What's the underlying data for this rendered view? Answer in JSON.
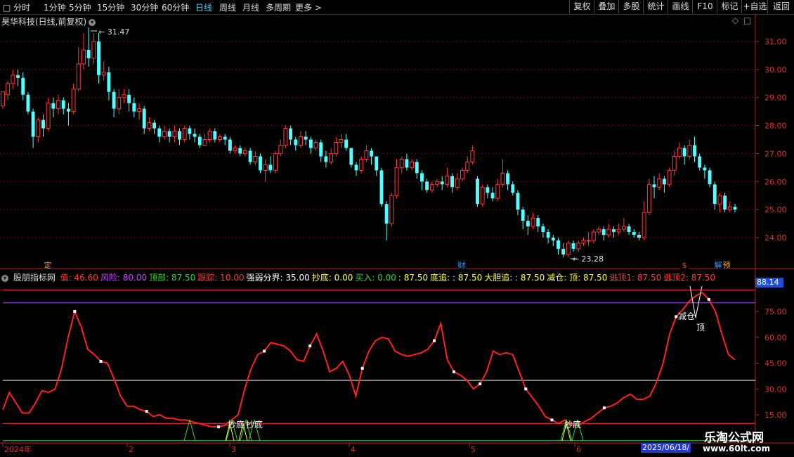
{
  "toolbar": {
    "periods": [
      "分时",
      "1分钟",
      "5分钟",
      "15分钟",
      "30分钟",
      "60分钟",
      "日线",
      "周线",
      "月线",
      "多周期",
      "更多"
    ],
    "active_period": "日线",
    "buttons": [
      "复权",
      "叠加",
      "多股",
      "统计",
      "画线",
      "F10",
      "标记",
      "+自选",
      "返回"
    ]
  },
  "chart_title": "昊华科技(日线,前复权)",
  "price_axis": [
    "31.00",
    "30.00",
    "29.00",
    "28.00",
    "27.00",
    "26.00",
    "25.00",
    "24.00"
  ],
  "high_label": "31.47",
  "low_label": "23.28",
  "event_badges": [
    {
      "text": "定",
      "color": "#f5a623"
    },
    {
      "text": "财",
      "color": "#3ba0ff"
    },
    {
      "text": "$",
      "color": "#ff3030"
    },
    {
      "text": "解",
      "color": "#3ba0ff"
    },
    {
      "text": "预",
      "color": "#f5a623"
    }
  ],
  "indicator": {
    "name": "股朋指标网",
    "items": [
      {
        "text": "值: 46.60",
        "color": "#ff3b3b"
      },
      {
        "text": "风险: 80.00",
        "color": "#d040ff"
      },
      {
        "text": "顶部: 87.50",
        "color": "#3bd33b"
      },
      {
        "text": "跟踪: 10.00",
        "color": "#ff3b3b"
      },
      {
        "text": "强弱分界: 35.00",
        "color": "#ffffff"
      },
      {
        "text": "抄底: 0.00",
        "color": "#ffff40"
      },
      {
        "text": "买入: 0.00",
        "color": "#3bd33b"
      },
      {
        "text": ": 87.50",
        "color": "#ffff40"
      },
      {
        "text": "底追: : 87.50",
        "color": "#ffff40"
      },
      {
        "text": "大胆追: : 87.50",
        "color": "#ffff40"
      },
      {
        "text": "减仓: 顶: 87.50",
        "color": "#ffff40"
      },
      {
        "text": "逃顶1: 87.50",
        "color": "#ff3b3b"
      },
      {
        "text": "逃顶2: 87.50",
        "color": "#ff3b3b"
      }
    ],
    "axis": [
      "75.00",
      "60.00",
      "45.00",
      "30.00",
      "15.00"
    ],
    "current_value": "88.14",
    "signal_labels": [
      "抄底",
      "抄底",
      "抄底",
      "减仓",
      "顶"
    ]
  },
  "date_axis": [
    "2024年",
    "2",
    "3",
    "4",
    "5",
    "6"
  ],
  "cursor_date": "2025/06/18/",
  "watermark": {
    "name": "乐淘公式网",
    "url": "www.60lt.com"
  },
  "chart_data": {
    "type": "candlestick",
    "price_range": [
      23.0,
      31.8
    ],
    "candles": [
      [
        28.7,
        29.2,
        29.2,
        28.6
      ],
      [
        29.1,
        29.5,
        29.6,
        28.9
      ],
      [
        29.5,
        29.8,
        30.0,
        29.3
      ],
      [
        29.8,
        29.7,
        30.0,
        29.4
      ],
      [
        29.7,
        29.1,
        29.9,
        28.9
      ],
      [
        29.1,
        28.5,
        29.2,
        28.4
      ],
      [
        28.5,
        27.6,
        28.6,
        27.2
      ],
      [
        27.6,
        28.2,
        28.3,
        27.4
      ],
      [
        28.2,
        27.9,
        28.4,
        27.6
      ],
      [
        27.9,
        28.8,
        29.0,
        27.8
      ],
      [
        28.8,
        28.6,
        29.0,
        28.3
      ],
      [
        28.6,
        28.9,
        29.1,
        28.4
      ],
      [
        28.9,
        28.6,
        29.0,
        28.4
      ],
      [
        28.6,
        28.5,
        28.8,
        28.0
      ],
      [
        28.5,
        29.3,
        29.5,
        28.4
      ],
      [
        29.3,
        30.2,
        30.8,
        29.2
      ],
      [
        30.2,
        30.7,
        31.3,
        30.0
      ],
      [
        30.7,
        30.4,
        31.5,
        30.1
      ],
      [
        30.4,
        31.0,
        31.3,
        30.2
      ],
      [
        31.0,
        29.8,
        31.3,
        29.5
      ],
      [
        29.8,
        29.9,
        30.3,
        29.6
      ],
      [
        29.9,
        29.2,
        30.1,
        28.9
      ],
      [
        29.2,
        28.6,
        29.3,
        28.3
      ],
      [
        28.6,
        29.0,
        29.3,
        28.4
      ],
      [
        29.0,
        29.1,
        29.3,
        28.8
      ],
      [
        29.1,
        28.8,
        29.3,
        28.5
      ],
      [
        28.8,
        28.5,
        29.0,
        28.3
      ],
      [
        28.5,
        28.6,
        28.8,
        28.2
      ],
      [
        28.6,
        27.9,
        28.7,
        27.7
      ],
      [
        27.9,
        28.1,
        28.3,
        27.8
      ],
      [
        28.1,
        27.9,
        28.2,
        27.7
      ],
      [
        27.9,
        27.6,
        28.0,
        27.4
      ],
      [
        27.6,
        27.8,
        28.0,
        27.5
      ],
      [
        27.8,
        27.6,
        27.9,
        27.4
      ],
      [
        27.6,
        27.8,
        28.0,
        27.4
      ],
      [
        27.8,
        27.5,
        27.9,
        27.3
      ],
      [
        27.5,
        27.9,
        28.0,
        27.4
      ],
      [
        27.9,
        27.7,
        28.0,
        27.5
      ],
      [
        27.7,
        27.6,
        27.9,
        27.4
      ],
      [
        27.6,
        27.3,
        27.7,
        27.2
      ],
      [
        27.3,
        27.5,
        27.7,
        27.3
      ],
      [
        27.5,
        27.8,
        27.9,
        27.4
      ],
      [
        27.8,
        27.5,
        27.9,
        27.4
      ],
      [
        27.5,
        27.6,
        27.7,
        27.4
      ],
      [
        27.6,
        27.5,
        27.7,
        27.3
      ],
      [
        27.5,
        27.1,
        27.6,
        27.0
      ],
      [
        27.1,
        27.2,
        27.3,
        27.0
      ],
      [
        27.2,
        27.0,
        27.3,
        26.9
      ],
      [
        27.0,
        27.1,
        27.2,
        26.9
      ],
      [
        27.1,
        26.7,
        27.2,
        26.6
      ],
      [
        26.7,
        26.9,
        27.1,
        26.6
      ],
      [
        26.9,
        26.4,
        27.0,
        26.3
      ],
      [
        26.4,
        26.6,
        26.8,
        26.0
      ],
      [
        26.6,
        26.4,
        26.9,
        26.3
      ],
      [
        26.4,
        27.0,
        27.1,
        26.3
      ],
      [
        27.0,
        27.3,
        27.5,
        26.9
      ],
      [
        27.3,
        27.9,
        28.0,
        27.2
      ],
      [
        27.9,
        27.5,
        28.0,
        27.3
      ],
      [
        27.5,
        27.3,
        27.6,
        27.1
      ],
      [
        27.3,
        27.6,
        27.8,
        27.2
      ],
      [
        27.6,
        27.5,
        27.8,
        27.3
      ],
      [
        27.5,
        27.2,
        27.6,
        27.0
      ],
      [
        27.2,
        27.4,
        27.5,
        27.1
      ],
      [
        27.4,
        26.9,
        27.5,
        26.7
      ],
      [
        26.9,
        26.7,
        27.1,
        26.5
      ],
      [
        26.7,
        27.0,
        27.2,
        26.6
      ],
      [
        27.0,
        27.4,
        27.6,
        26.9
      ],
      [
        27.4,
        27.5,
        27.7,
        27.2
      ],
      [
        27.5,
        27.2,
        27.7,
        27.1
      ],
      [
        27.2,
        26.6,
        27.2,
        26.5
      ],
      [
        26.6,
        26.4,
        26.7,
        26.2
      ],
      [
        26.4,
        26.8,
        26.9,
        26.3
      ],
      [
        26.8,
        27.1,
        27.3,
        26.7
      ],
      [
        27.1,
        26.9,
        27.2,
        26.6
      ],
      [
        26.9,
        26.4,
        26.9,
        26.2
      ],
      [
        26.4,
        25.2,
        26.5,
        25.1
      ],
      [
        25.2,
        24.5,
        25.3,
        23.9
      ],
      [
        24.5,
        25.5,
        25.6,
        24.4
      ],
      [
        25.5,
        26.5,
        26.8,
        25.4
      ],
      [
        26.5,
        26.8,
        26.9,
        26.3
      ],
      [
        26.8,
        26.5,
        27.0,
        26.4
      ],
      [
        26.5,
        26.7,
        26.8,
        26.4
      ],
      [
        26.7,
        26.3,
        26.8,
        26.1
      ],
      [
        26.3,
        26.0,
        26.4,
        25.7
      ],
      [
        26.0,
        25.7,
        26.1,
        25.6
      ],
      [
        25.7,
        25.9,
        26.0,
        25.6
      ],
      [
        25.9,
        26.0,
        26.1,
        25.8
      ],
      [
        26.0,
        25.9,
        26.2,
        25.7
      ],
      [
        25.9,
        26.2,
        26.5,
        25.8
      ],
      [
        26.2,
        25.8,
        26.3,
        25.6
      ],
      [
        25.8,
        26.1,
        26.3,
        25.7
      ],
      [
        26.1,
        26.4,
        26.5,
        26.0
      ],
      [
        26.4,
        26.7,
        26.9,
        26.3
      ],
      [
        26.7,
        27.1,
        27.3,
        26.6
      ],
      [
        26.1,
        25.2,
        26.2,
        25.1
      ],
      [
        25.2,
        25.8,
        25.9,
        25.1
      ],
      [
        25.8,
        25.6,
        25.9,
        25.4
      ],
      [
        25.6,
        25.4,
        25.8,
        25.3
      ],
      [
        25.4,
        25.9,
        26.1,
        25.3
      ],
      [
        25.9,
        26.3,
        26.8,
        25.8
      ],
      [
        26.3,
        25.9,
        26.4,
        25.7
      ],
      [
        25.9,
        25.6,
        26.0,
        25.5
      ],
      [
        25.6,
        25.0,
        25.7,
        24.8
      ],
      [
        25.0,
        24.6,
        25.1,
        24.3
      ],
      [
        24.6,
        24.4,
        24.8,
        24.1
      ],
      [
        24.4,
        24.7,
        24.9,
        24.3
      ],
      [
        24.7,
        24.4,
        24.8,
        24.2
      ],
      [
        24.4,
        24.2,
        24.5,
        24.0
      ],
      [
        24.2,
        24.0,
        24.3,
        23.8
      ],
      [
        24.0,
        23.9,
        24.1,
        23.7
      ],
      [
        23.9,
        23.6,
        24.0,
        23.4
      ],
      [
        23.6,
        23.4,
        23.8,
        23.3
      ],
      [
        23.4,
        23.8,
        23.9,
        23.3
      ],
      [
        23.8,
        23.6,
        23.9,
        23.5
      ],
      [
        23.6,
        23.8,
        23.9,
        23.5
      ],
      [
        23.8,
        23.9,
        24.0,
        23.7
      ],
      [
        23.9,
        23.9,
        24.2,
        23.7
      ],
      [
        23.9,
        24.2,
        24.3,
        23.8
      ],
      [
        24.2,
        24.3,
        24.4,
        24.1
      ],
      [
        24.3,
        24.1,
        24.4,
        23.9
      ],
      [
        24.1,
        24.3,
        24.5,
        24.0
      ],
      [
        24.3,
        24.2,
        24.4,
        24.0
      ],
      [
        24.2,
        24.3,
        24.5,
        24.1
      ],
      [
        24.3,
        24.4,
        24.7,
        24.2
      ],
      [
        24.4,
        24.2,
        24.5,
        24.1
      ],
      [
        24.2,
        24.1,
        24.3,
        24.0
      ],
      [
        24.1,
        24.0,
        24.2,
        23.9
      ],
      [
        24.0,
        24.9,
        25.3,
        23.9
      ],
      [
        24.9,
        25.9,
        26.1,
        24.8
      ],
      [
        25.9,
        25.8,
        26.2,
        25.4
      ],
      [
        25.8,
        26.1,
        26.3,
        25.7
      ],
      [
        26.1,
        25.9,
        26.2,
        25.6
      ],
      [
        25.9,
        26.4,
        26.5,
        25.8
      ],
      [
        26.4,
        26.9,
        27.1,
        26.2
      ],
      [
        26.9,
        27.2,
        27.4,
        26.8
      ],
      [
        27.2,
        26.9,
        27.3,
        26.6
      ],
      [
        26.9,
        27.3,
        27.5,
        26.8
      ],
      [
        27.3,
        26.9,
        27.6,
        26.7
      ],
      [
        26.9,
        26.5,
        27.0,
        26.4
      ],
      [
        26.5,
        26.4,
        26.6,
        26.1
      ],
      [
        26.4,
        25.9,
        26.5,
        25.8
      ],
      [
        25.9,
        25.2,
        26.0,
        25.0
      ],
      [
        25.2,
        25.5,
        25.6,
        24.9
      ],
      [
        25.5,
        25.0,
        25.6,
        24.9
      ],
      [
        25.0,
        25.1,
        25.3,
        24.9
      ],
      [
        25.1,
        25.0,
        25.2,
        24.9
      ]
    ],
    "indicator_line": [
      18,
      28,
      22,
      16,
      16,
      22,
      29,
      28,
      30,
      42,
      60,
      75,
      66,
      53,
      50,
      46,
      45,
      36,
      26,
      20,
      20,
      18,
      17,
      14,
      15,
      13,
      13,
      12,
      12,
      11,
      10,
      9,
      8,
      8,
      9,
      12,
      15,
      30,
      42,
      50,
      52,
      57,
      56,
      55,
      52,
      47,
      46,
      55,
      62,
      52,
      40,
      42,
      46,
      38,
      26,
      42,
      52,
      58,
      60,
      59,
      52,
      50,
      49,
      50,
      51,
      53,
      58,
      68,
      47,
      40,
      38,
      35,
      30,
      33,
      40,
      52,
      50,
      51,
      50,
      40,
      30,
      25,
      20,
      14,
      12,
      10,
      12,
      9,
      9,
      11,
      13,
      16,
      19,
      20,
      22,
      25,
      27,
      24,
      24,
      26,
      34,
      45,
      62,
      72,
      76,
      81,
      84,
      86,
      82,
      75,
      62,
      50,
      47
    ]
  }
}
